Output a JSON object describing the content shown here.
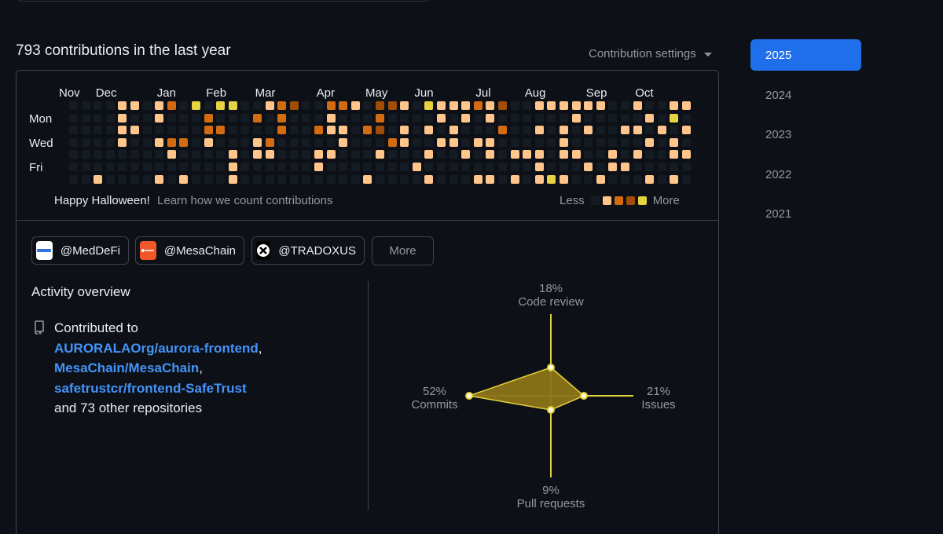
{
  "heading": "793 contributions in the last year",
  "settings_label": "Contribution settings",
  "months": [
    {
      "label": "Nov",
      "col": 0
    },
    {
      "label": "Dec",
      "col": 3
    },
    {
      "label": "Jan",
      "col": 8
    },
    {
      "label": "Feb",
      "col": 12
    },
    {
      "label": "Mar",
      "col": 16
    },
    {
      "label": "Apr",
      "col": 21
    },
    {
      "label": "May",
      "col": 25
    },
    {
      "label": "Jun",
      "col": 29
    },
    {
      "label": "Jul",
      "col": 34
    },
    {
      "label": "Aug",
      "col": 38
    },
    {
      "label": "Sep",
      "col": 43
    },
    {
      "label": "Oct",
      "col": 47
    }
  ],
  "day_labels": [
    {
      "label": "Mon",
      "row": 1
    },
    {
      "label": "Wed",
      "row": 3
    },
    {
      "label": "Fri",
      "row": 5
    }
  ],
  "calendar": {
    "rows": [
      "000000000000000000000000000000000000000000000000000",
      "000000000000000000000000000000000000000000000000000",
      "000000000000000000000000000000000000000000000000000",
      "000000000000000000000000000000000000000000000000000",
      "000000000000000000000000000000000000000000000000000",
      "000000000000000000000000000000000000000000000000000",
      "000000000000000000000000000000000000000000000000000"
    ],
    "level_colors": [
      "#151b23",
      "#ffc58b",
      "#d36b10",
      "#a24d05",
      "#e6d342"
    ],
    "weeks": [
      "0000000",
      "0000000",
      "0000001",
      "0000000",
      "1111000",
      "1010000",
      "0000000",
      "1101001",
      "2002100",
      "0002001",
      "4000000",
      "0221000",
      "4020000",
      "4000111",
      "0000000",
      "0201100",
      "1002100",
      "2220000",
      "3000000",
      "0000000",
      "0020110",
      "2110100",
      "2011000",
      "1000000",
      "0020001",
      "3230100",
      "3002000",
      "1011000",
      "0000010",
      "4010101",
      "1101000",
      "1011000",
      "1100100",
      "2001001",
      "1101101",
      "3020000",
      "0000101",
      "0000100",
      "1010111",
      "1000004",
      "1011101",
      "1100100",
      "1010010",
      "1000001",
      "0000110",
      "0010010",
      "1010100",
      "0101001",
      "0010000",
      "1401101",
      "1010100"
    ]
  },
  "footer": {
    "greeting": "Happy Halloween!",
    "learn_link": "Learn how we count contributions",
    "less": "Less",
    "more": "More"
  },
  "orgs": [
    {
      "label": "@MedDeFi",
      "logo_bg": "#ffffff",
      "logo_fg": "#2f6fe4",
      "logo_icon": "meddefi-logo"
    },
    {
      "label": "@MesaChain",
      "logo_bg": "#f2572a",
      "logo_fg": "#ffffff",
      "logo_icon": "mesachain-logo"
    },
    {
      "label": "@TRADOXUS",
      "logo_bg": "#000000",
      "logo_fg": "#ffffff",
      "logo_icon": "tradoxus-logo"
    }
  ],
  "more_button": "More",
  "overview": {
    "title": "Activity overview",
    "contributed_to": "Contributed to",
    "repos": [
      {
        "name": "AURORALAOrg/aurora-frontend",
        "suffix": ","
      },
      {
        "name": "MesaChain/MesaChain",
        "suffix": ","
      },
      {
        "name": "safetrustcr/frontend-SafeTrust",
        "suffix": ""
      }
    ],
    "others": "and 73 other repositories"
  },
  "radar": {
    "accent": "#e3cf3c",
    "fill": "#8c7418",
    "axes": [
      {
        "label": "Code review",
        "value_label": "18%",
        "percent": 18
      },
      {
        "label": "Issues",
        "value_label": "21%",
        "percent": 21
      },
      {
        "label": "Pull requests",
        "value_label": "9%",
        "percent": 9
      },
      {
        "label": "Commits",
        "value_label": "52%",
        "percent": 52
      }
    ]
  },
  "years": [
    "2025",
    "2024",
    "2023",
    "2022",
    "2021"
  ],
  "active_year": "2025"
}
